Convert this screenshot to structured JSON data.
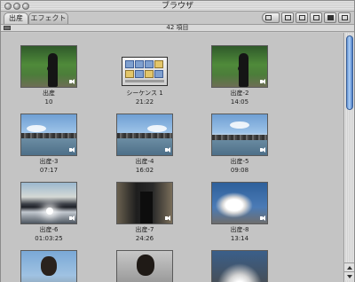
{
  "window": {
    "title": "ブラウザ"
  },
  "tabs": [
    {
      "label": "出産"
    },
    {
      "label": "エフェクト"
    }
  ],
  "status": {
    "item_count": "42 項目"
  },
  "clips": [
    {
      "name": "出産",
      "duration": "10",
      "thumb": "park",
      "audio": true
    },
    {
      "name": "シーケンス 1",
      "duration": "21:22",
      "thumb": "sequence",
      "audio": false
    },
    {
      "name": "出産-2",
      "duration": "14:05",
      "thumb": "park",
      "audio": true
    },
    {
      "name": "出産-3",
      "duration": "07:17",
      "thumb": "city",
      "audio": true
    },
    {
      "name": "出産-4",
      "duration": "16:02",
      "thumb": "city",
      "audio": true
    },
    {
      "name": "出産-5",
      "duration": "09:08",
      "thumb": "city",
      "audio": true
    },
    {
      "name": "出産-6",
      "duration": "01:03:25",
      "thumb": "sunset",
      "audio": true
    },
    {
      "name": "出産-7",
      "duration": "24:26",
      "thumb": "dark",
      "audio": true
    },
    {
      "name": "出産-8",
      "duration": "13:14",
      "thumb": "clouds",
      "audio": true
    },
    {
      "name": "",
      "duration": "",
      "thumb": "person",
      "audio": false
    },
    {
      "name": "",
      "duration": "",
      "thumb": "person2",
      "audio": false
    },
    {
      "name": "",
      "duration": "",
      "thumb": "flare",
      "audio": false
    }
  ],
  "icons": {
    "toolbar": [
      "view-toggle-icon",
      "list-view-icon",
      "column-view-icon",
      "icon-view-icon",
      "large-icon-view-icon",
      "extra-large-icon-view-icon"
    ],
    "speaker": "speaker-icon",
    "sequence": "sequence-icon"
  }
}
